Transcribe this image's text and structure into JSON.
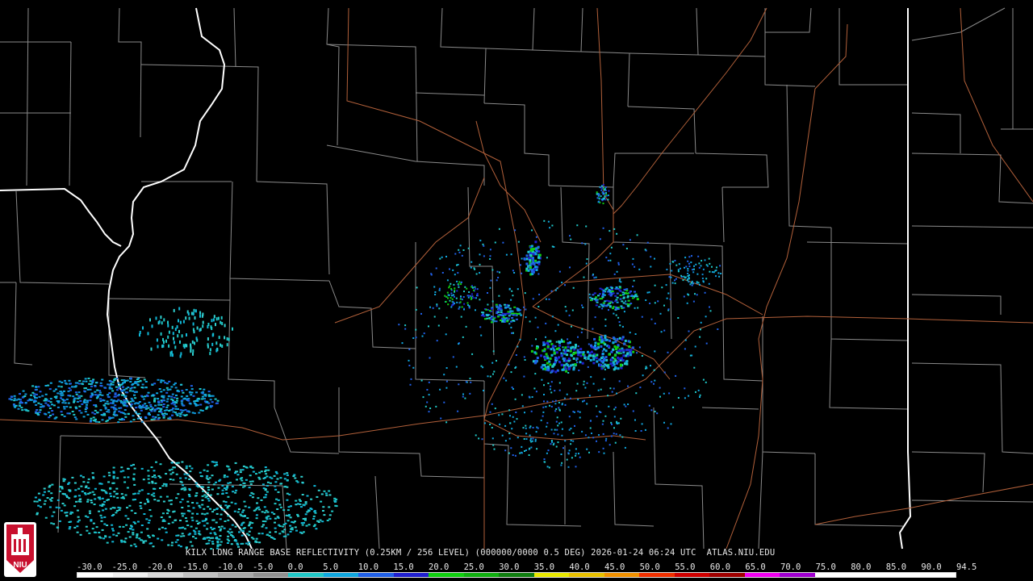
{
  "product_title": "KILX LONG RANGE BASE REFLECTIVITY (0.25KM / 256 LEVEL) (000000/0000 0.5 DEG) 2026-01-24 06:24 UTC  ATLAS.NIU.EDU",
  "colorbar": {
    "labels": [
      "-30.0",
      "-25.0",
      "-20.0",
      "-15.0",
      "-10.0",
      "-5.0",
      "0.0",
      "5.0",
      "10.0",
      "15.0",
      "20.0",
      "25.0",
      "30.0",
      "35.0",
      "40.0",
      "45.0",
      "50.0",
      "55.0",
      "60.0",
      "65.0",
      "70.0",
      "75.0",
      "80.0",
      "85.0",
      "90.0",
      "94.5"
    ],
    "colors": [
      "#ffffff",
      "#f0f0f0",
      "#d8d8d8",
      "#c0c0c0",
      "#a8a8a8",
      "#909090",
      "#20c8c8",
      "#10a8e0",
      "#2060e8",
      "#2020d0",
      "#10d010",
      "#10b010",
      "#108010",
      "#e8e800",
      "#e8c000",
      "#f09000",
      "#f03000",
      "#d00000",
      "#a00000",
      "#f000f0",
      "#a000d0",
      "#ffffff",
      "#ffffff",
      "#ffffff",
      "#ffffff"
    ]
  },
  "logo": {
    "text": "NIU",
    "bg_color": "#c8102e"
  },
  "colors": {
    "county": "#8a8a8a",
    "state": "#ffffff",
    "road": "#b2603a"
  }
}
